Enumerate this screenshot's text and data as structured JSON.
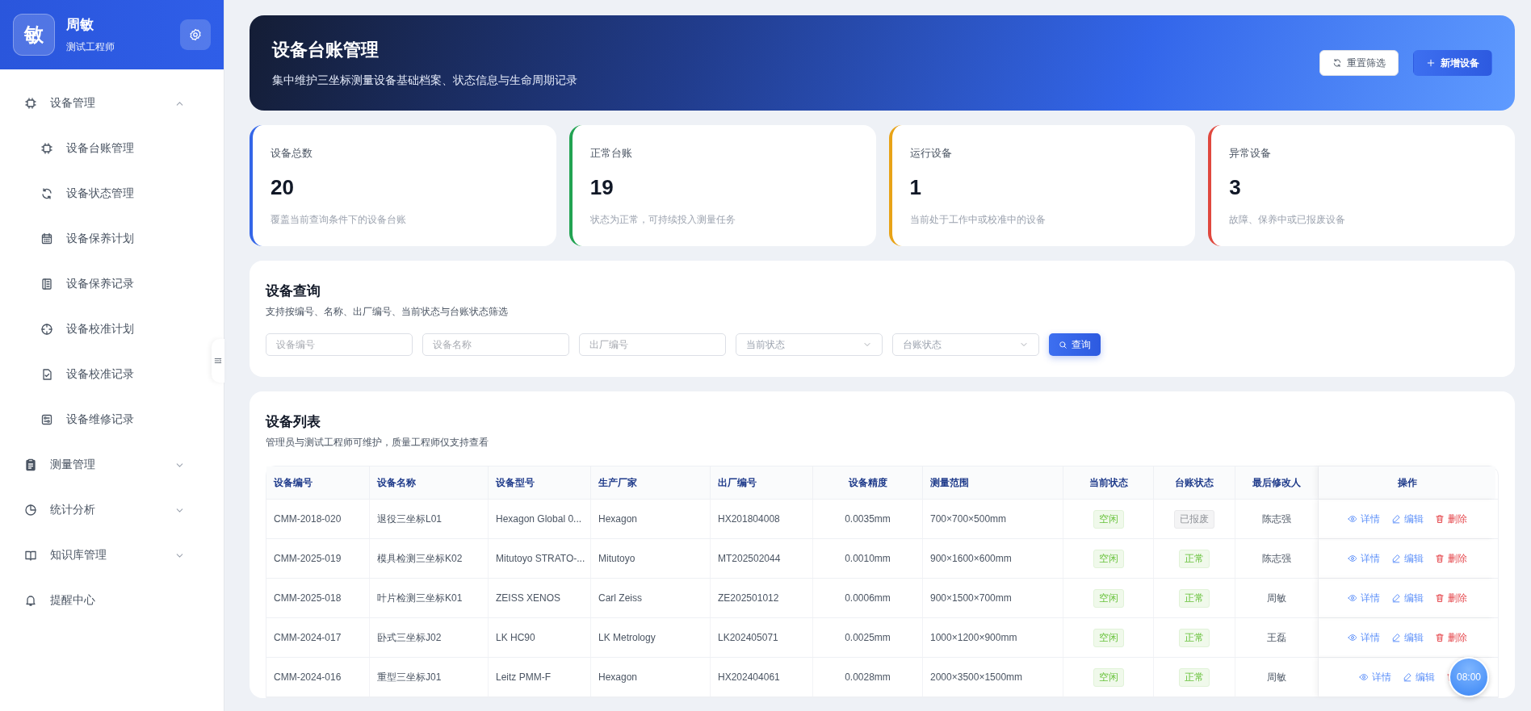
{
  "sidebar": {
    "user": {
      "avatar": "敏",
      "name": "周敏",
      "role": "测试工程师"
    },
    "menu": [
      {
        "label": "设备管理",
        "expanded": true,
        "children": [
          {
            "label": "设备台账管理",
            "selected": false
          },
          {
            "label": "设备状态管理",
            "selected": false
          },
          {
            "label": "设备保养计划",
            "selected": false
          },
          {
            "label": "设备保养记录",
            "selected": false
          },
          {
            "label": "设备校准计划",
            "selected": false
          },
          {
            "label": "设备校准记录",
            "selected": false
          },
          {
            "label": "设备维修记录",
            "selected": false
          }
        ]
      },
      {
        "label": "测量管理",
        "expanded": false
      },
      {
        "label": "统计分析",
        "expanded": false
      },
      {
        "label": "知识库管理",
        "expanded": false
      },
      {
        "label": "提醒中心"
      }
    ]
  },
  "banner": {
    "title": "设备台账管理",
    "subtitle": "集中维护三坐标测量设备基础档案、状态信息与生命周期记录",
    "buttons": [
      {
        "label": "重置筛选",
        "kind": "secondary"
      },
      {
        "label": "新增设备",
        "kind": "primary"
      }
    ]
  },
  "stats": [
    {
      "label": "设备总数",
      "value": "20",
      "note": "覆盖当前查询条件下的设备台账",
      "color": "#3466e8"
    },
    {
      "label": "正常台账",
      "value": "19",
      "note": "状态为正常，可持续投入测量任务",
      "color": "#22a352"
    },
    {
      "label": "运行设备",
      "value": "1",
      "note": "当前处于工作中或校准中的设备",
      "color": "#e8a317"
    },
    {
      "label": "异常设备",
      "value": "3",
      "note": "故障、保养中或已报废设备",
      "color": "#e0483e"
    }
  ],
  "query": {
    "title": "设备查询",
    "subtitle": "支持按编号、名称、出厂编号、当前状态与台账状态筛选",
    "fields": [
      {
        "placeholder": "设备编号",
        "kind": "input"
      },
      {
        "placeholder": "设备名称",
        "kind": "input"
      },
      {
        "placeholder": "出厂编号",
        "kind": "input"
      },
      {
        "placeholder": "当前状态",
        "kind": "select"
      },
      {
        "placeholder": "台账状态",
        "kind": "select"
      }
    ],
    "button": "查询"
  },
  "list": {
    "title": "设备列表",
    "subtitle": "管理员与测试工程师可维护，质量工程师仅支持查看",
    "columns": [
      "设备编号",
      "设备名称",
      "设备型号",
      "生产厂家",
      "出厂编号",
      "设备精度",
      "测量范围",
      "当前状态",
      "台账状态",
      "最后修改人",
      "操作"
    ],
    "rows": [
      {
        "cells": [
          "CMM-2018-020",
          "退役三坐标L01",
          "Hexagon Global 0...",
          "Hexagon",
          "HX201804008",
          "0.0035mm",
          "700×700×500mm"
        ],
        "status": {
          "label": "空闲",
          "kind": "idle"
        },
        "ledger": {
          "label": "已报废",
          "kind": "scrapped"
        },
        "modifier": "陈志强",
        "actions": [
          {
            "label": "详情",
            "kind": "view"
          },
          {
            "label": "编辑",
            "kind": "edit"
          },
          {
            "label": "删除",
            "kind": "delete"
          }
        ]
      },
      {
        "cells": [
          "CMM-2025-019",
          "模具检测三坐标K02",
          "Mitutoyo STRATO-...",
          "Mitutoyo",
          "MT202502044",
          "0.0010mm",
          "900×1600×600mm"
        ],
        "status": {
          "label": "空闲",
          "kind": "idle"
        },
        "ledger": {
          "label": "正常",
          "kind": "normal"
        },
        "modifier": "陈志强",
        "actions": [
          {
            "label": "详情",
            "kind": "view"
          },
          {
            "label": "编辑",
            "kind": "edit"
          },
          {
            "label": "删除",
            "kind": "delete"
          }
        ]
      },
      {
        "cells": [
          "CMM-2025-018",
          "叶片检测三坐标K01",
          "ZEISS XENOS",
          "Carl Zeiss",
          "ZE202501012",
          "0.0006mm",
          "900×1500×700mm"
        ],
        "status": {
          "label": "空闲",
          "kind": "idle"
        },
        "ledger": {
          "label": "正常",
          "kind": "normal"
        },
        "modifier": "周敏",
        "actions": [
          {
            "label": "详情",
            "kind": "view"
          },
          {
            "label": "编辑",
            "kind": "edit"
          },
          {
            "label": "删除",
            "kind": "delete"
          }
        ]
      },
      {
        "cells": [
          "CMM-2024-017",
          "卧式三坐标J02",
          "LK HC90",
          "LK Metrology",
          "LK202405071",
          "0.0025mm",
          "1000×1200×900mm"
        ],
        "status": {
          "label": "空闲",
          "kind": "idle"
        },
        "ledger": {
          "label": "正常",
          "kind": "normal"
        },
        "modifier": "王磊",
        "actions": [
          {
            "label": "详情",
            "kind": "view"
          },
          {
            "label": "编辑",
            "kind": "edit"
          },
          {
            "label": "删除",
            "kind": "delete"
          }
        ]
      },
      {
        "cells": [
          "CMM-2024-016",
          "重型三坐标J01",
          "Leitz PMM-F",
          "Hexagon",
          "HX202404061",
          "0.0028mm",
          "2000×3500×1500mm"
        ],
        "status": {
          "label": "空闲",
          "kind": "idle"
        },
        "ledger": {
          "label": "正常",
          "kind": "normal"
        },
        "modifier": "周敏",
        "actions": [
          {
            "label": "详情",
            "kind": "view"
          },
          {
            "label": "编辑",
            "kind": "edit"
          },
          {
            "kind": "delete"
          }
        ]
      }
    ]
  },
  "timer": "08:00"
}
